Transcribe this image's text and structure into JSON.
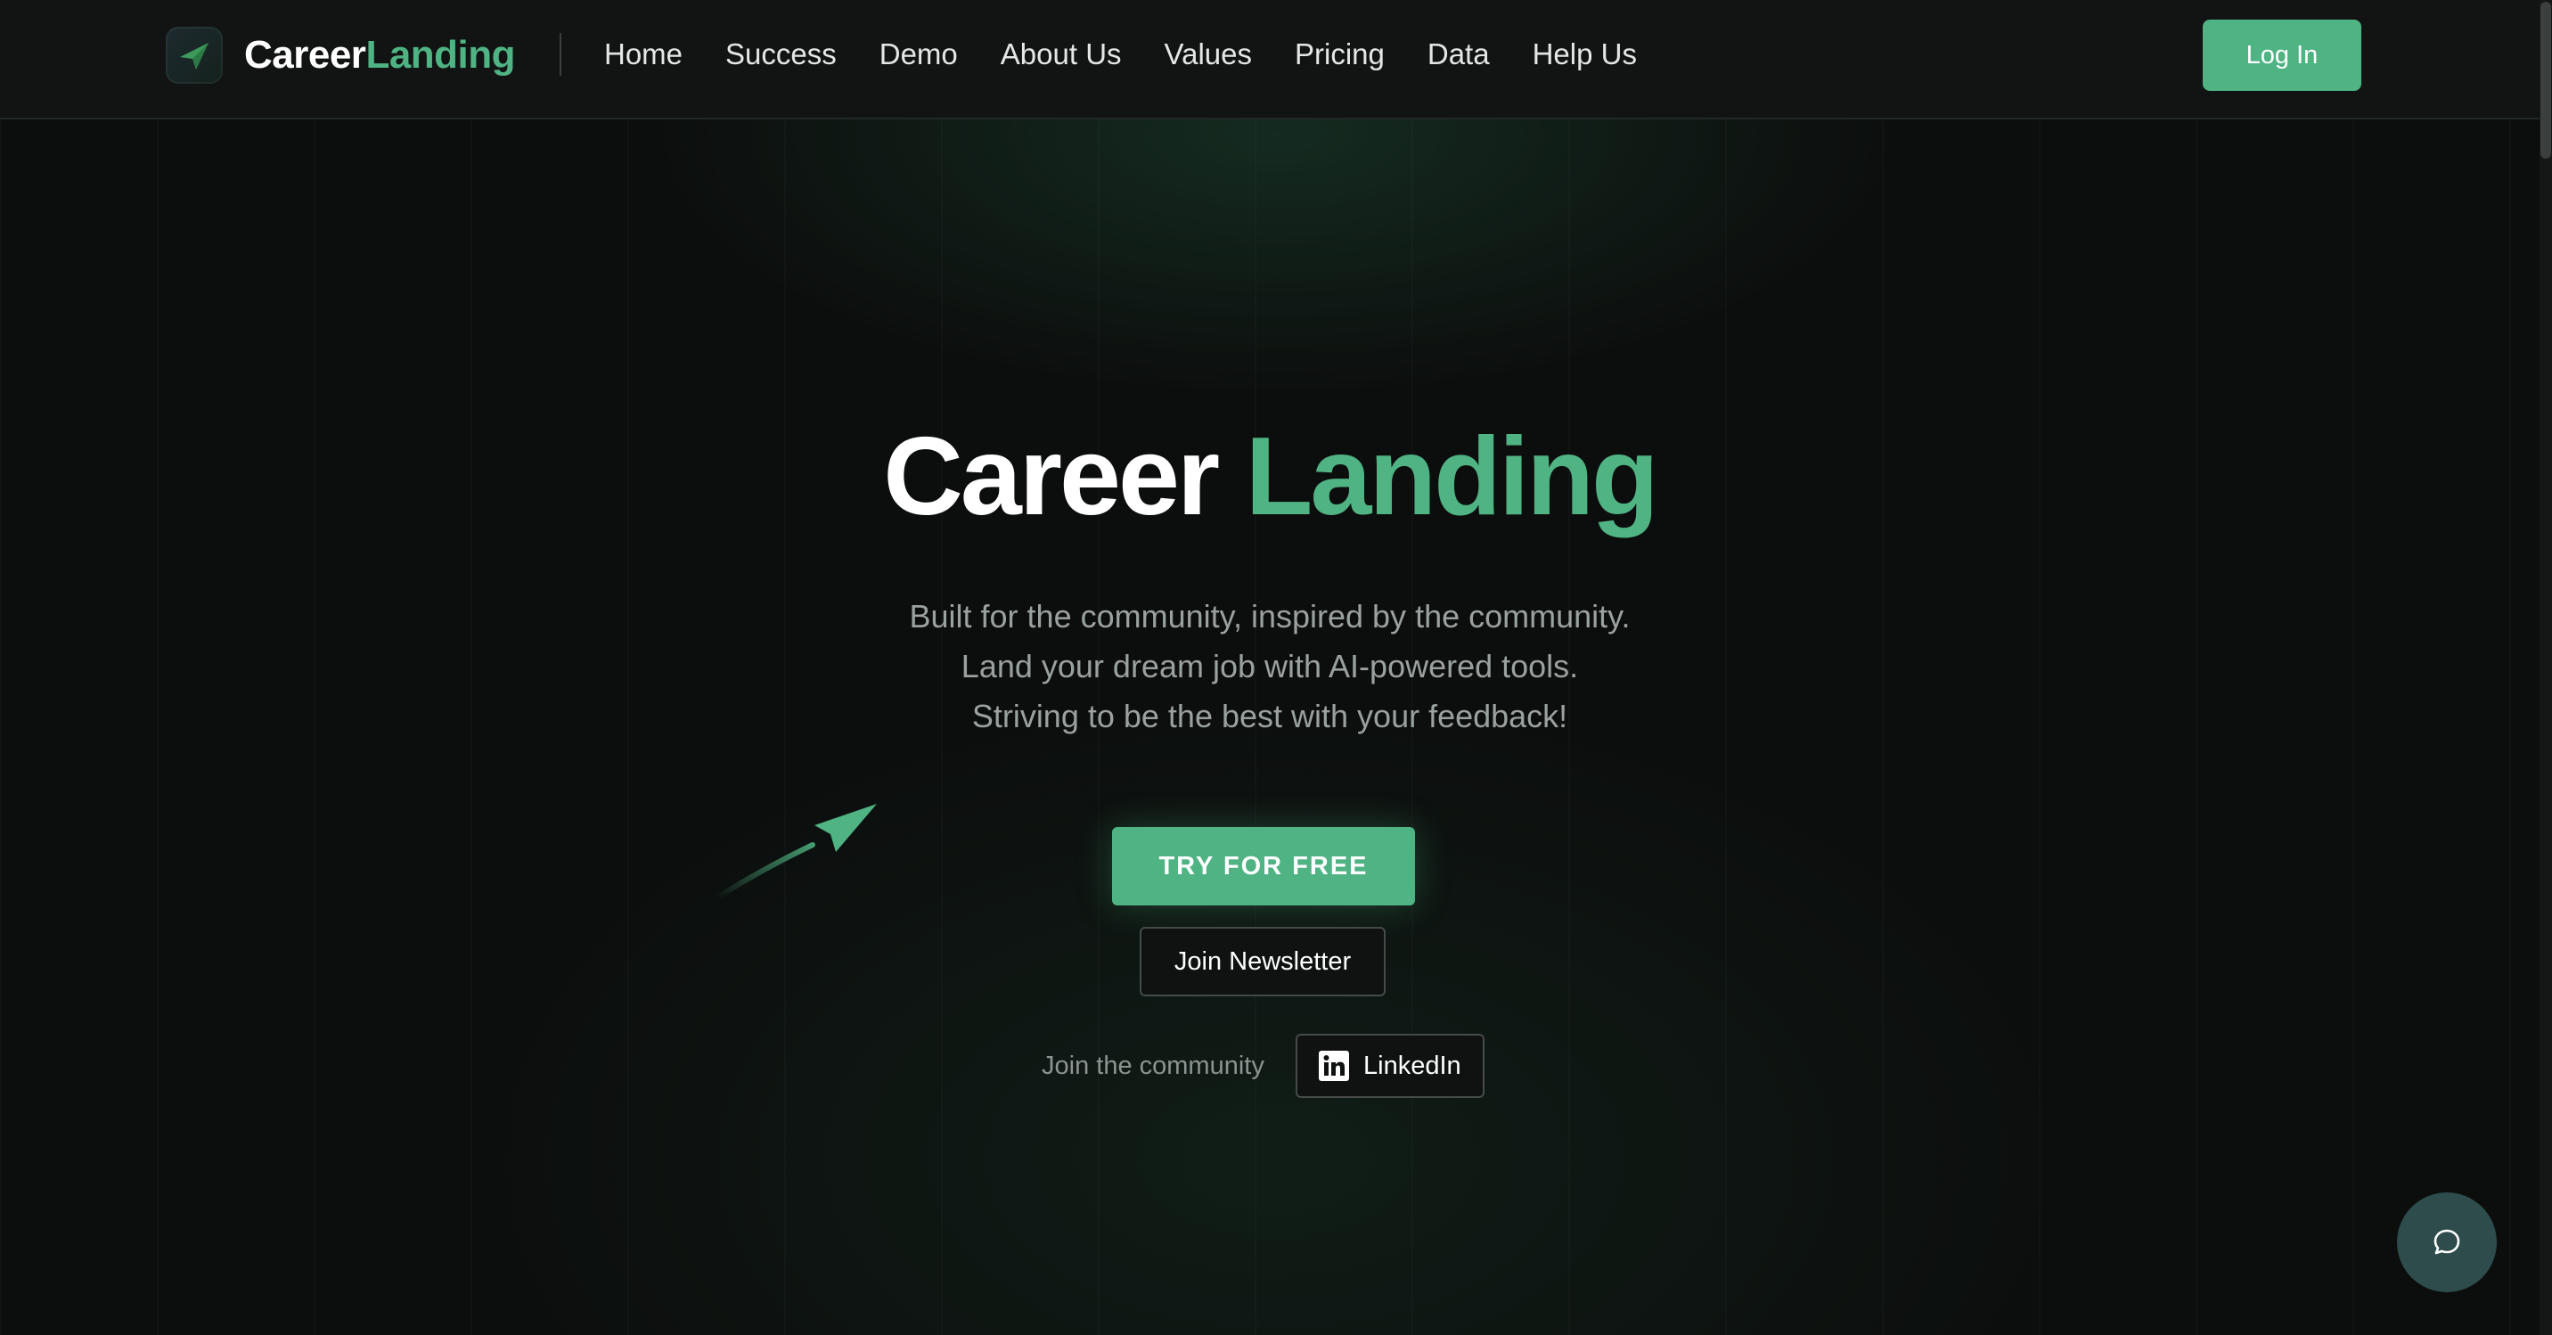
{
  "brand": {
    "name_part1": "Career",
    "name_part2": "Landing",
    "logo_icon": "paper-plane-icon"
  },
  "nav": {
    "items": [
      "Home",
      "Success",
      "Demo",
      "About Us",
      "Values",
      "Pricing",
      "Data",
      "Help Us"
    ]
  },
  "header": {
    "login_label": "Log In"
  },
  "hero": {
    "title_word1": "Career",
    "title_word2": "Landing",
    "subtitle_lines": [
      "Built for the community, inspired by the community.",
      "Land your dream job with AI-powered tools.",
      "Striving to be the best with your feedback!"
    ],
    "decoration_icon": "paper-plane-icon"
  },
  "cta": {
    "try_label": "TRY FOR FREE",
    "newsletter_label": "Join Newsletter"
  },
  "community": {
    "label": "Join the community",
    "linkedin_label": "LinkedIn",
    "linkedin_icon": "linkedin-icon"
  },
  "chat": {
    "icon": "chat-bubble-icon"
  },
  "colors": {
    "accent": "#4fb383",
    "background": "#0c0e0d",
    "header_bg": "#111413",
    "chat_button": "#2d4c4b"
  }
}
